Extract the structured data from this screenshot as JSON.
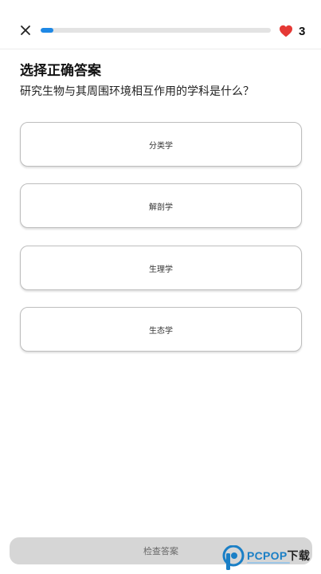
{
  "header": {
    "close_icon": "close-icon",
    "progress": 0.055,
    "progress_color": "#1e88e5",
    "heart_icon": "heart-icon",
    "heart_color": "#e53935",
    "hearts": "3"
  },
  "question": {
    "title": "选择正确答案",
    "text": "研究生物与其周围环境相互作用的学科是什么？"
  },
  "options": [
    {
      "label": "分类学"
    },
    {
      "label": "解剖学"
    },
    {
      "label": "生理学"
    },
    {
      "label": "生态学"
    }
  ],
  "footer": {
    "check_label": "检查答案"
  },
  "watermark": {
    "brand": "PCPOP",
    "suffix": "下载"
  }
}
